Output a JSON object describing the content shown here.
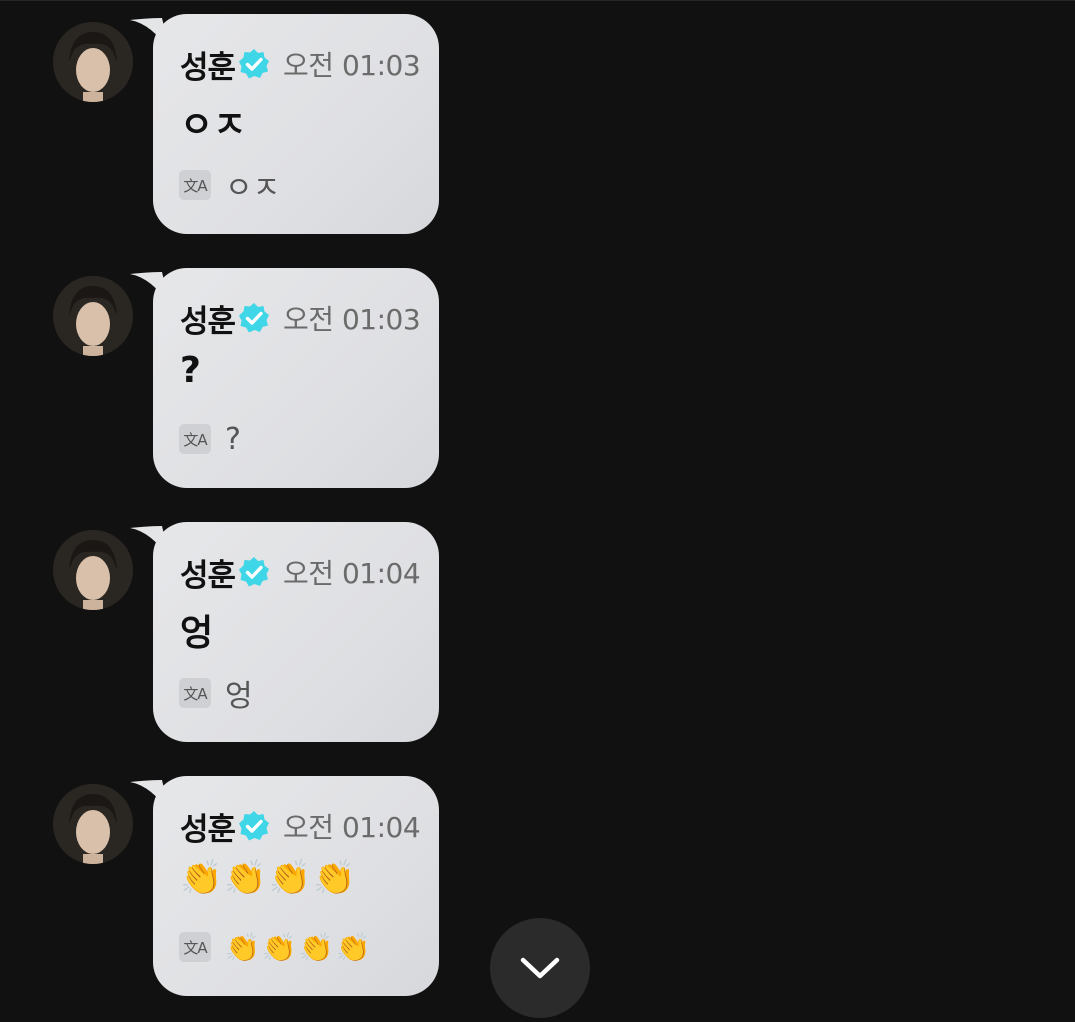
{
  "messages": [
    {
      "name": "성훈",
      "time": "오전 01:03",
      "text": "ㅇㅈ",
      "translation": "ㅇㅈ"
    },
    {
      "name": "성훈",
      "time": "오전 01:03",
      "text": "?",
      "translation": "?"
    },
    {
      "name": "성훈",
      "time": "오전 01:04",
      "text": "엉",
      "translation": "엉"
    },
    {
      "name": "성훈",
      "time": "오전 01:04",
      "text": "👏👏👏👏",
      "translation": "👏👏👏👏"
    }
  ],
  "translate_icon_label": "文A",
  "icons": {
    "verified": "verified-badge-icon",
    "translate": "translate-icon",
    "scroll_down": "chevron-down-icon"
  },
  "colors": {
    "background": "#111111",
    "bubble": "#e2e3e6",
    "verified": "#3fd6e8",
    "time": "#6b6b6b"
  }
}
